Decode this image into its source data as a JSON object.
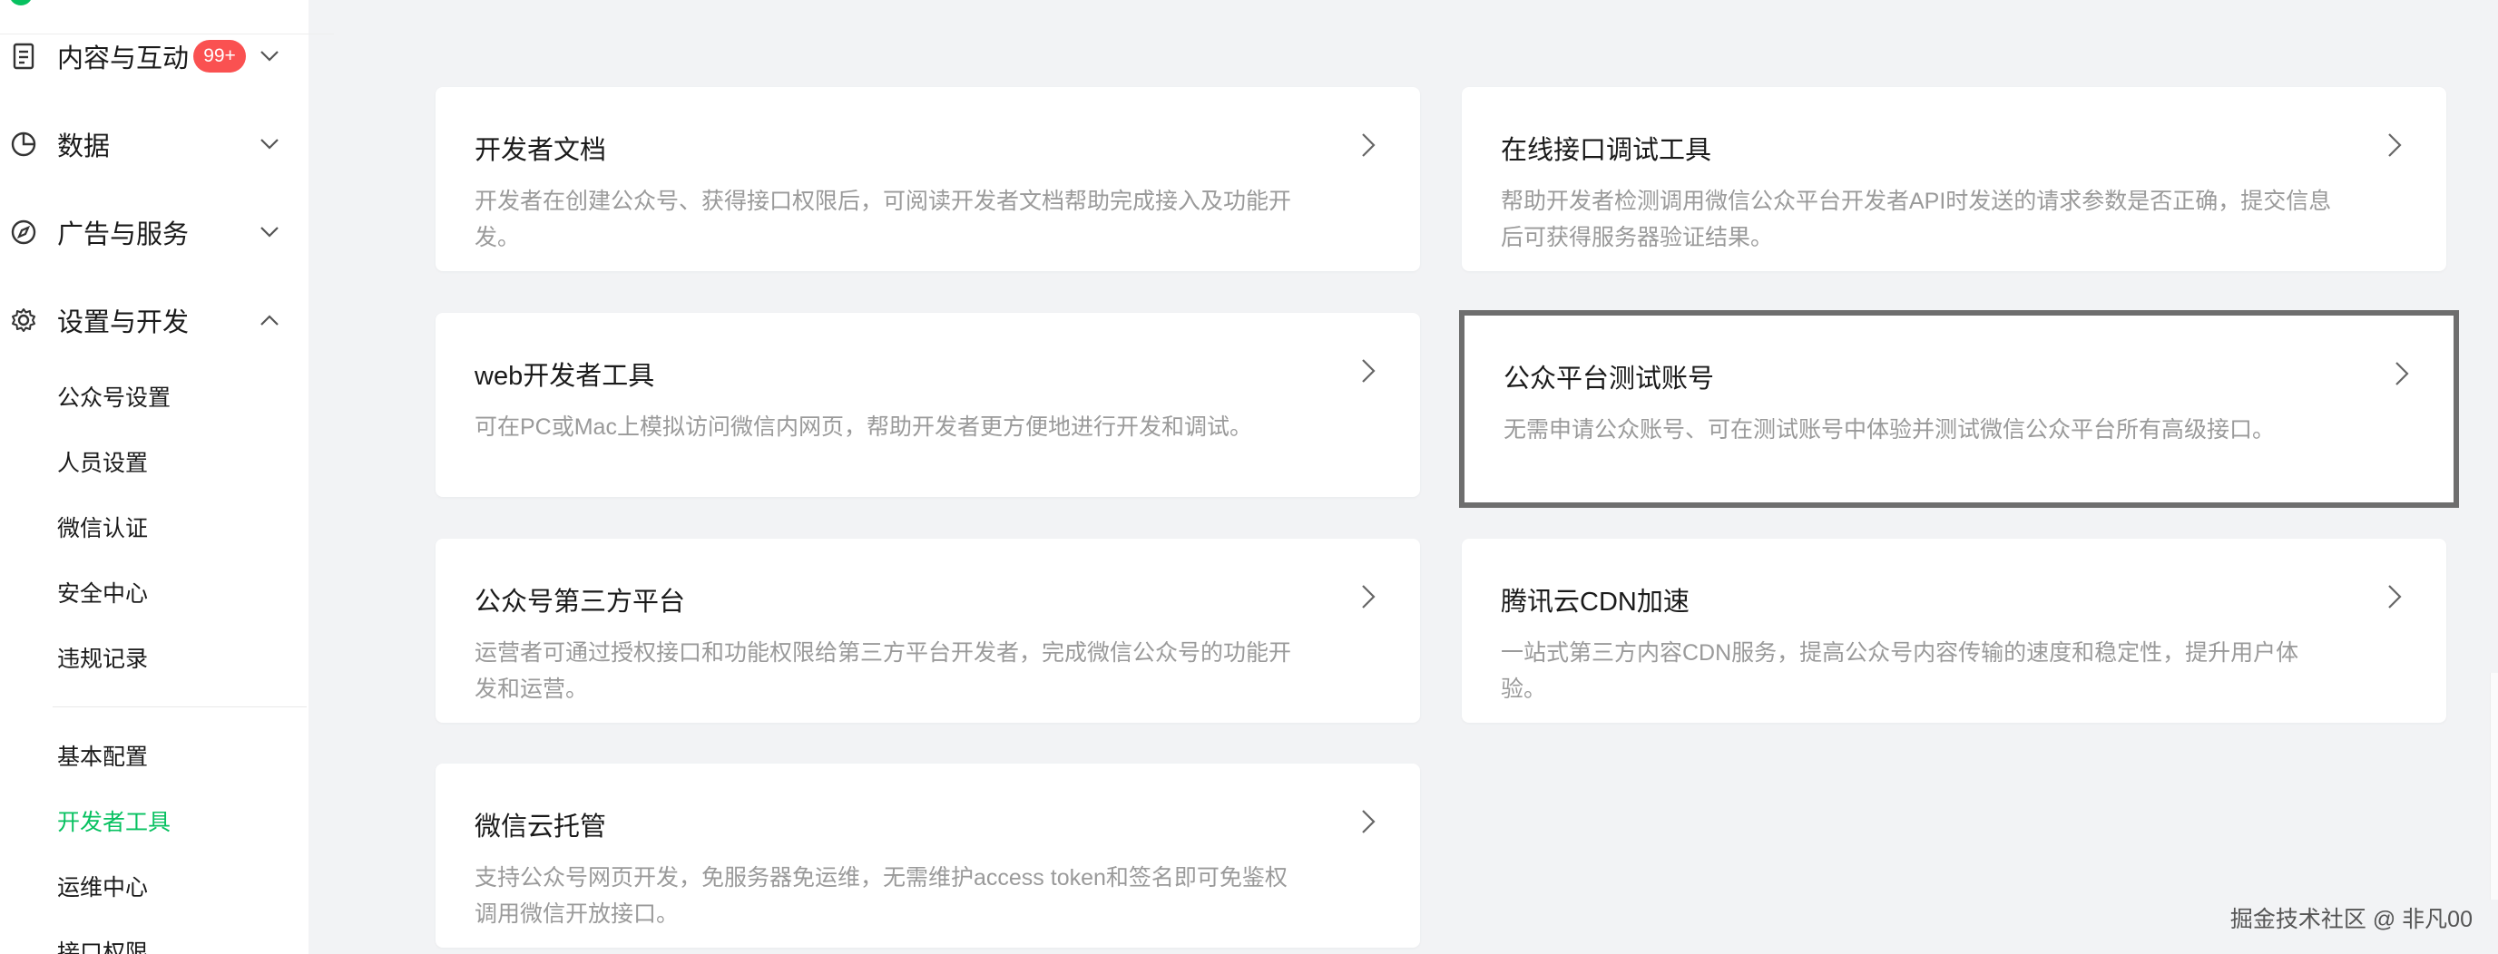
{
  "colors": {
    "accent": "#07c160",
    "badge": "#fa5151",
    "selected_outline": "#6e6e6e"
  },
  "sidebar": {
    "groups": [
      {
        "label": "内容与互动",
        "icon": "document-icon",
        "badge": "99+",
        "expanded": false
      },
      {
        "label": "数据",
        "icon": "pie-chart-icon",
        "expanded": false
      },
      {
        "label": "广告与服务",
        "icon": "compass-icon",
        "expanded": false
      },
      {
        "label": "设置与开发",
        "icon": "gear-icon",
        "expanded": true
      }
    ],
    "sub_items_a": [
      "公众号设置",
      "人员设置",
      "微信认证",
      "安全中心",
      "违规记录"
    ],
    "sub_items_b": [
      "基本配置",
      "开发者工具",
      "运维中心",
      "接口权限"
    ],
    "active_item": "开发者工具"
  },
  "cards": [
    {
      "title": "开发者文档",
      "desc": "开发者在创建公众号、获得接口权限后，可阅读开发者文档帮助完成接入及功能开发。"
    },
    {
      "title": "在线接口调试工具",
      "desc": "帮助开发者检测调用微信公众平台开发者API时发送的请求参数是否正确，提交信息后可获得服务器验证结果。"
    },
    {
      "title": "web开发者工具",
      "desc": "可在PC或Mac上模拟访问微信内网页，帮助开发者更方便地进行开发和调试。"
    },
    {
      "title": "公众平台测试账号",
      "desc": "无需申请公众账号、可在测试账号中体验并测试微信公众平台所有高级接口。"
    },
    {
      "title": "公众号第三方平台",
      "desc": "运营者可通过授权接口和功能权限给第三方平台开发者，完成微信公众号的功能开发和运营。"
    },
    {
      "title": "腾讯云CDN加速",
      "desc": "一站式第三方内容CDN服务，提高公众号内容传输的速度和稳定性，提升用户体验。"
    },
    {
      "title": "微信云托管",
      "desc": "支持公众号网页开发，免服务器免运维，无需维护access token和签名即可免鉴权调用微信开放接口。"
    }
  ],
  "selected_card": "公众平台测试账号",
  "watermark": "掘金技术社区 @ 非凡00"
}
